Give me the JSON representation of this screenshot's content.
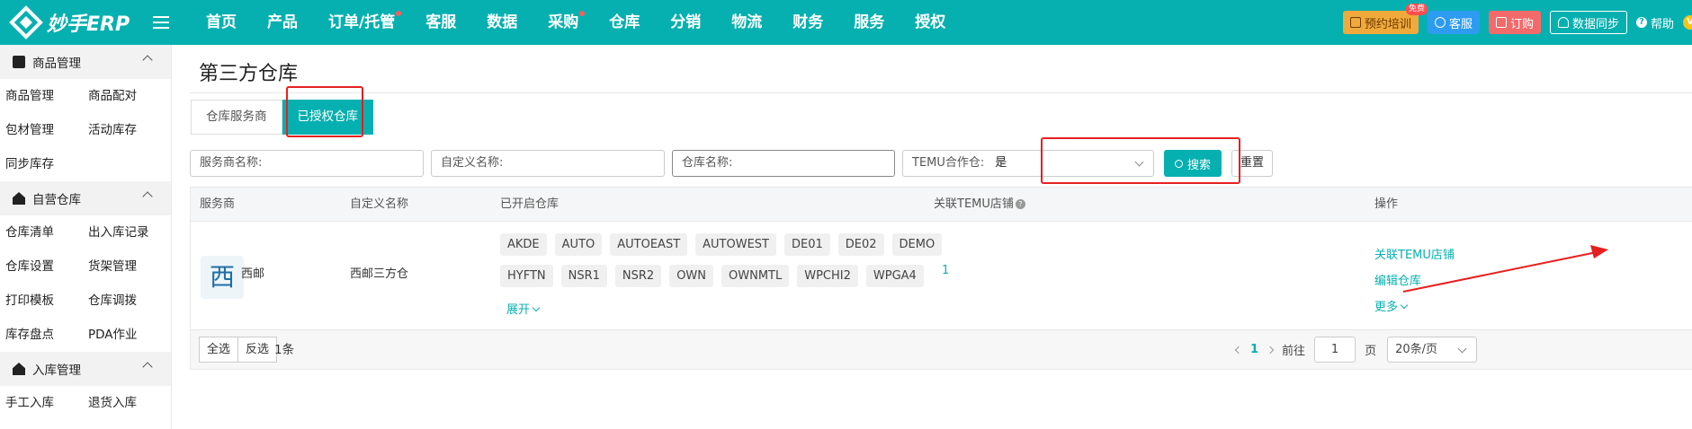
{
  "app": {
    "logo_text": "妙手ERP"
  },
  "nav": [
    {
      "label": "首页",
      "dot": false
    },
    {
      "label": "产品",
      "dot": false
    },
    {
      "label": "订单/托管",
      "dot": true
    },
    {
      "label": "客服",
      "dot": false
    },
    {
      "label": "数据",
      "dot": false
    },
    {
      "label": "采购",
      "dot": true
    },
    {
      "label": "仓库",
      "dot": false
    },
    {
      "label": "分销",
      "dot": false
    },
    {
      "label": "物流",
      "dot": false
    },
    {
      "label": "财务",
      "dot": false
    },
    {
      "label": "服务",
      "dot": false
    },
    {
      "label": "授权",
      "dot": false
    }
  ],
  "topright": {
    "train": "预约培训",
    "train_badge": "免费",
    "service": "客服",
    "order": "订购",
    "sync": "数据同步",
    "help": "帮助",
    "avatar": "V"
  },
  "sidebar": {
    "sections": [
      {
        "title": "商品管理",
        "icon": "clipboard-icon",
        "items": [
          "商品管理",
          "商品配对",
          "包材管理",
          "活动库存",
          "同步库存"
        ]
      },
      {
        "title": "自营仓库",
        "icon": "house-icon",
        "items": [
          "仓库清单",
          "出入库记录",
          "仓库设置",
          "货架管理",
          "打印模板",
          "仓库调拨",
          "库存盘点",
          "PDA作业"
        ]
      },
      {
        "title": "入库管理",
        "icon": "house-icon",
        "items": [
          "手工入库",
          "退货入库"
        ]
      }
    ]
  },
  "page": {
    "title": "第三方仓库",
    "tabs": [
      {
        "label": "仓库服务商",
        "active": false
      },
      {
        "label": "已授权仓库",
        "active": true
      }
    ]
  },
  "filters": {
    "provider": "服务商名称:",
    "custom": "自定义名称:",
    "warehouse": "仓库名称:",
    "temu_label": "TEMU合作仓:",
    "temu_value": "是",
    "search": "搜索",
    "reset": "重置"
  },
  "table": {
    "headers": {
      "provider": "服务商",
      "custom": "自定义名称",
      "warehouses": "已开启仓库",
      "temu_shops": "关联TEMU店铺",
      "ops": "操作"
    },
    "rows": [
      {
        "avatar": "西",
        "provider": "西邮",
        "custom": "西邮三方仓",
        "tags_row1": [
          "AKDE",
          "AUTO",
          "AUTOEAST",
          "AUTOWEST",
          "DE01",
          "DE02",
          "DEMO"
        ],
        "tags_row2": [
          "HYFTN",
          "NSR1",
          "NSR2",
          "OWN",
          "OWNMTL",
          "WPCHI2",
          "WPGA4"
        ],
        "expand": "展开",
        "temu_count": "1",
        "op_link": "关联TEMU店铺",
        "op_edit": "编辑仓库",
        "op_more": "更多"
      }
    ]
  },
  "footer": {
    "select_all": "全选",
    "invert": "反选",
    "count": "1条",
    "page": "1",
    "goto": "前往",
    "goto_value": "1",
    "page_unit": "页",
    "page_size": "20条/页"
  },
  "colors": {
    "brand": "#07b0b0",
    "annotation": "#e62020"
  }
}
